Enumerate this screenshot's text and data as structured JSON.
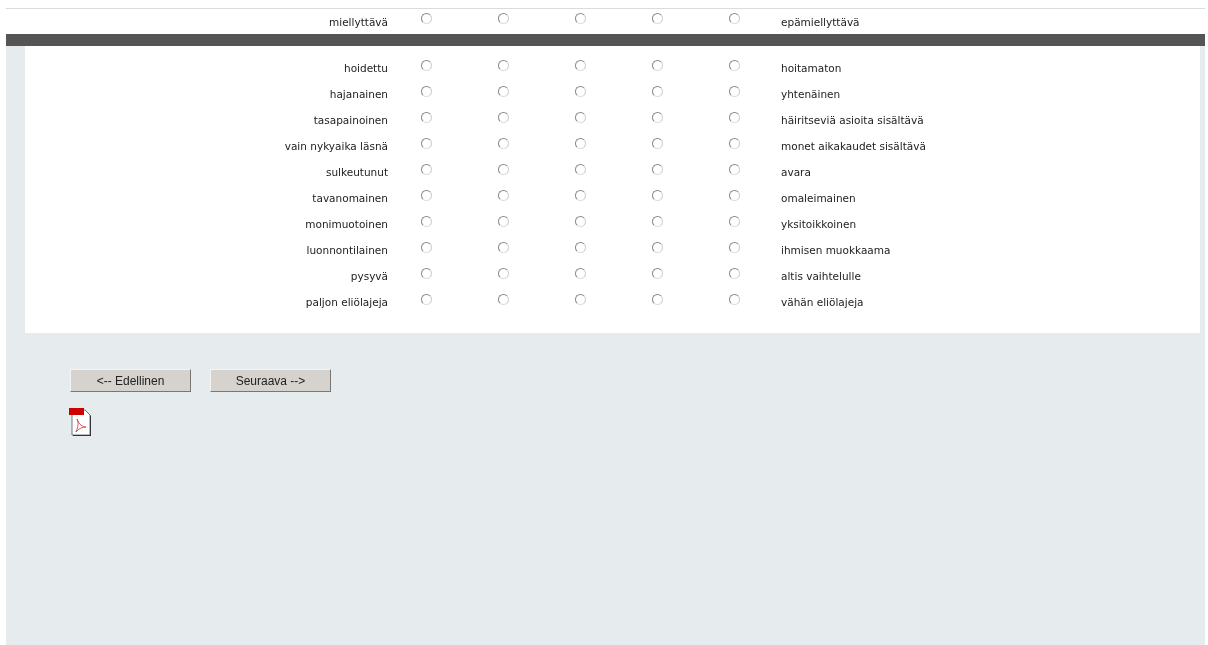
{
  "top_row": {
    "left": "miellyttävä",
    "right": "epämiellyttävä",
    "options": [
      {
        "selected": false
      },
      {
        "selected": false
      },
      {
        "selected": false
      },
      {
        "selected": false
      },
      {
        "selected": false
      }
    ]
  },
  "rows": [
    {
      "left": "hoidettu",
      "right": "hoitamaton",
      "options": [
        {
          "selected": false
        },
        {
          "selected": false
        },
        {
          "selected": false
        },
        {
          "selected": false
        },
        {
          "selected": false
        }
      ]
    },
    {
      "left": "hajanainen",
      "right": "yhtenäinen",
      "options": [
        {
          "selected": false
        },
        {
          "selected": false
        },
        {
          "selected": false
        },
        {
          "selected": false
        },
        {
          "selected": false
        }
      ]
    },
    {
      "left": "tasapainoinen",
      "right": "häiritseviä asioita sisältävä",
      "options": [
        {
          "selected": false
        },
        {
          "selected": false
        },
        {
          "selected": false
        },
        {
          "selected": false
        },
        {
          "selected": false
        }
      ]
    },
    {
      "left": "vain nykyaika läsnä",
      "right": "monet aikakaudet sisältävä",
      "options": [
        {
          "selected": false
        },
        {
          "selected": false
        },
        {
          "selected": false
        },
        {
          "selected": false
        },
        {
          "selected": false
        }
      ]
    },
    {
      "left": "sulkeutunut",
      "right": "avara",
      "options": [
        {
          "selected": false
        },
        {
          "selected": false
        },
        {
          "selected": false
        },
        {
          "selected": false
        },
        {
          "selected": false
        }
      ]
    },
    {
      "left": "tavanomainen",
      "right": "omaleimainen",
      "options": [
        {
          "selected": false
        },
        {
          "selected": false
        },
        {
          "selected": false
        },
        {
          "selected": false
        },
        {
          "selected": false
        }
      ]
    },
    {
      "left": "monimuotoinen",
      "right": "yksitoikkoinen",
      "options": [
        {
          "selected": false
        },
        {
          "selected": false
        },
        {
          "selected": false
        },
        {
          "selected": false
        },
        {
          "selected": false
        }
      ]
    },
    {
      "left": "luonnontilainen",
      "right": "ihmisen muokkaama",
      "options": [
        {
          "selected": false
        },
        {
          "selected": false
        },
        {
          "selected": false
        },
        {
          "selected": false
        },
        {
          "selected": false
        }
      ]
    },
    {
      "left": "pysyvä",
      "right": "altis vaihtelulle",
      "options": [
        {
          "selected": false
        },
        {
          "selected": false
        },
        {
          "selected": false
        },
        {
          "selected": false
        },
        {
          "selected": false
        }
      ]
    },
    {
      "left": "paljon eliölajeja",
      "right": "vähän eliölajeja",
      "options": [
        {
          "selected": false
        },
        {
          "selected": false
        },
        {
          "selected": false
        },
        {
          "selected": false
        },
        {
          "selected": false
        }
      ]
    }
  ],
  "buttons": [
    {
      "label": "<-- Edellinen"
    },
    {
      "label": "Seuraava -->"
    }
  ]
}
